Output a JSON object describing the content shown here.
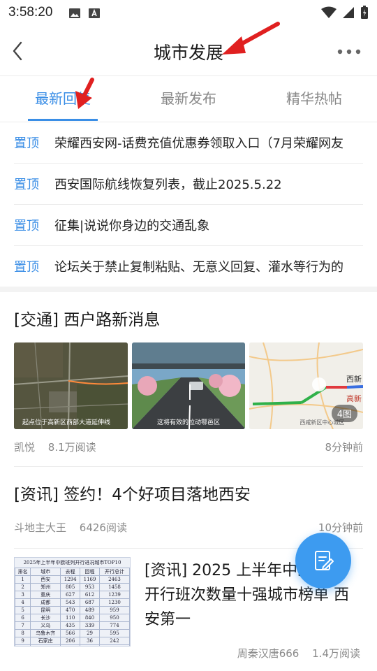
{
  "status": {
    "time": "3:58:20"
  },
  "nav": {
    "title": "城市发展"
  },
  "tabs": [
    {
      "label": "最新回复"
    },
    {
      "label": "最新发布"
    },
    {
      "label": "精华热帖"
    }
  ],
  "pinned": [
    {
      "tag": "置顶",
      "text": "荣耀西安网-话费充值优惠券领取入口（7月荣耀网友"
    },
    {
      "tag": "置顶",
      "text": "西安国际航线恢复列表，截止2025.5.22"
    },
    {
      "tag": "置顶",
      "text": "征集|说说你身边的交通乱象"
    },
    {
      "tag": "置顶",
      "text": "论坛关于禁止复制粘贴、无意义回复、灌水等行为的"
    }
  ],
  "posts": [
    {
      "title": "[交通] 西户路新消息",
      "author": "凯悦",
      "reads": "8.1万阅读",
      "time": "8分钟前",
      "images": [
        {
          "caption": "起点位于高新区西部大道延伸线"
        },
        {
          "caption": "这将有效的拉动鄠邑区"
        },
        {
          "caption": "西咸新区中心城区",
          "map_label": "西新",
          "map_label2": "高新"
        }
      ],
      "image_count": "4图"
    },
    {
      "title": "[资讯] 签约！4个好项目落地西安",
      "author": "斗地主大王",
      "reads": "6426阅读",
      "time": "10分钟前"
    },
    {
      "title": "[资讯] 2025 上半年中欧班列开行班次数量十强城市榜单 西安第一",
      "author": "周秦汉唐666",
      "reads": "1.4万阅读",
      "table": {
        "title": "2025年上半年中欧班列开行进况城市TOP10",
        "headers": [
          "排名",
          "城市",
          "去程",
          "回程",
          "开行总计"
        ],
        "rows": [
          [
            "1",
            "西安",
            "1294",
            "1169",
            "2463"
          ],
          [
            "2",
            "郑州",
            "805",
            "953",
            "1458"
          ],
          [
            "3",
            "重庆",
            "627",
            "612",
            "1239"
          ],
          [
            "4",
            "成都",
            "543",
            "687",
            "1230"
          ],
          [
            "5",
            "昆明",
            "470",
            "489",
            "959"
          ],
          [
            "6",
            "长沙",
            "110",
            "840",
            "950"
          ],
          [
            "7",
            "义乌",
            "435",
            "339",
            "774"
          ],
          [
            "8",
            "乌鲁木齐",
            "566",
            "29",
            "595"
          ],
          [
            "9",
            "石家庄",
            "206",
            "36",
            "242"
          ],
          [
            "10",
            "武汉",
            "226",
            "215",
            "441"
          ]
        ]
      }
    }
  ],
  "colors": {
    "accent": "#3a8ee6",
    "fab": "#3d9bf0",
    "annotation_arrow": "#e02020"
  }
}
